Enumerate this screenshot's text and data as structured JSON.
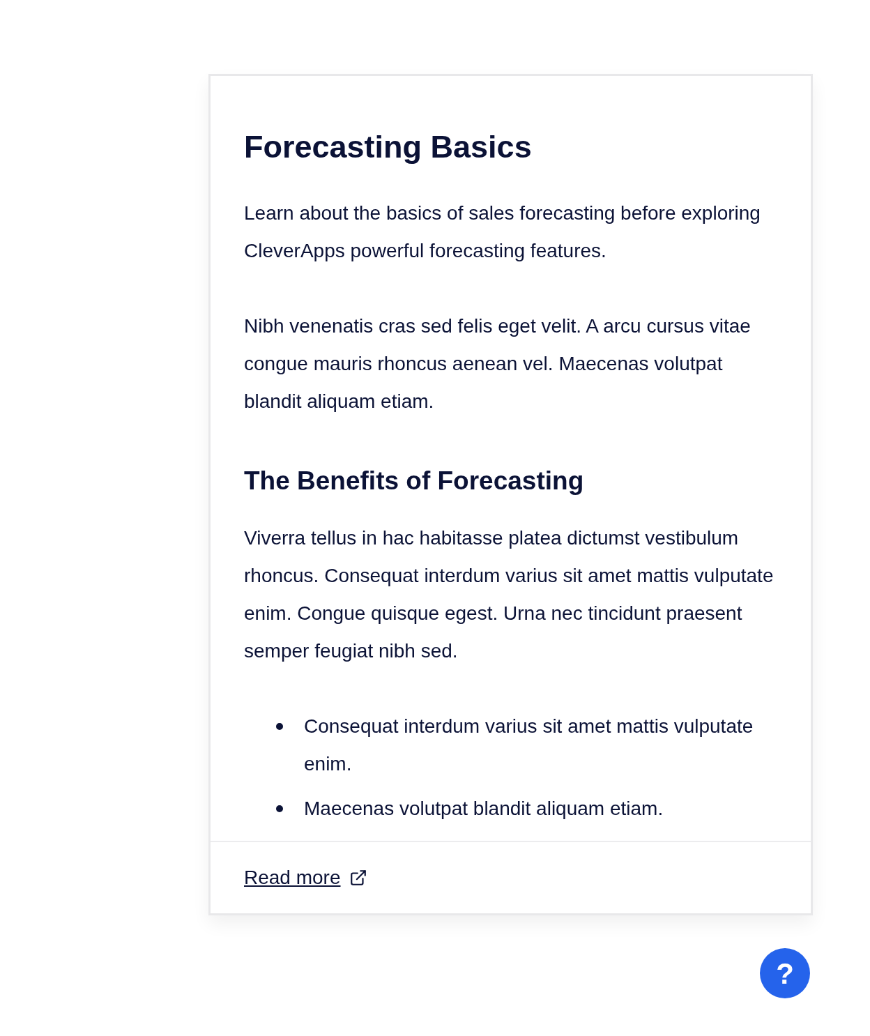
{
  "card": {
    "title": "Forecasting Basics",
    "intro": [
      "Learn about the basics of sales forecasting before exploring CleverApps powerful forecasting features.",
      "Nibh venenatis cras sed felis eget velit. A arcu cursus vitae congue mauris rhoncus aenean vel. Maecenas volutpat blandit aliquam etiam."
    ],
    "section_title": "The Benefits of Forecasting",
    "section_text": "Viverra tellus in hac habitasse platea dictumst vestibulum rhoncus. Consequat interdum varius sit amet mattis vulputate enim. Congue quisque egest. Urna nec tincidunt praesent semper feugiat nibh sed.",
    "bullets": [
      "Consequat interdum varius sit amet mattis vulputate enim.",
      "Maecenas volutpat blandit aliquam etiam."
    ],
    "link": "Read more"
  },
  "help_button": "?"
}
